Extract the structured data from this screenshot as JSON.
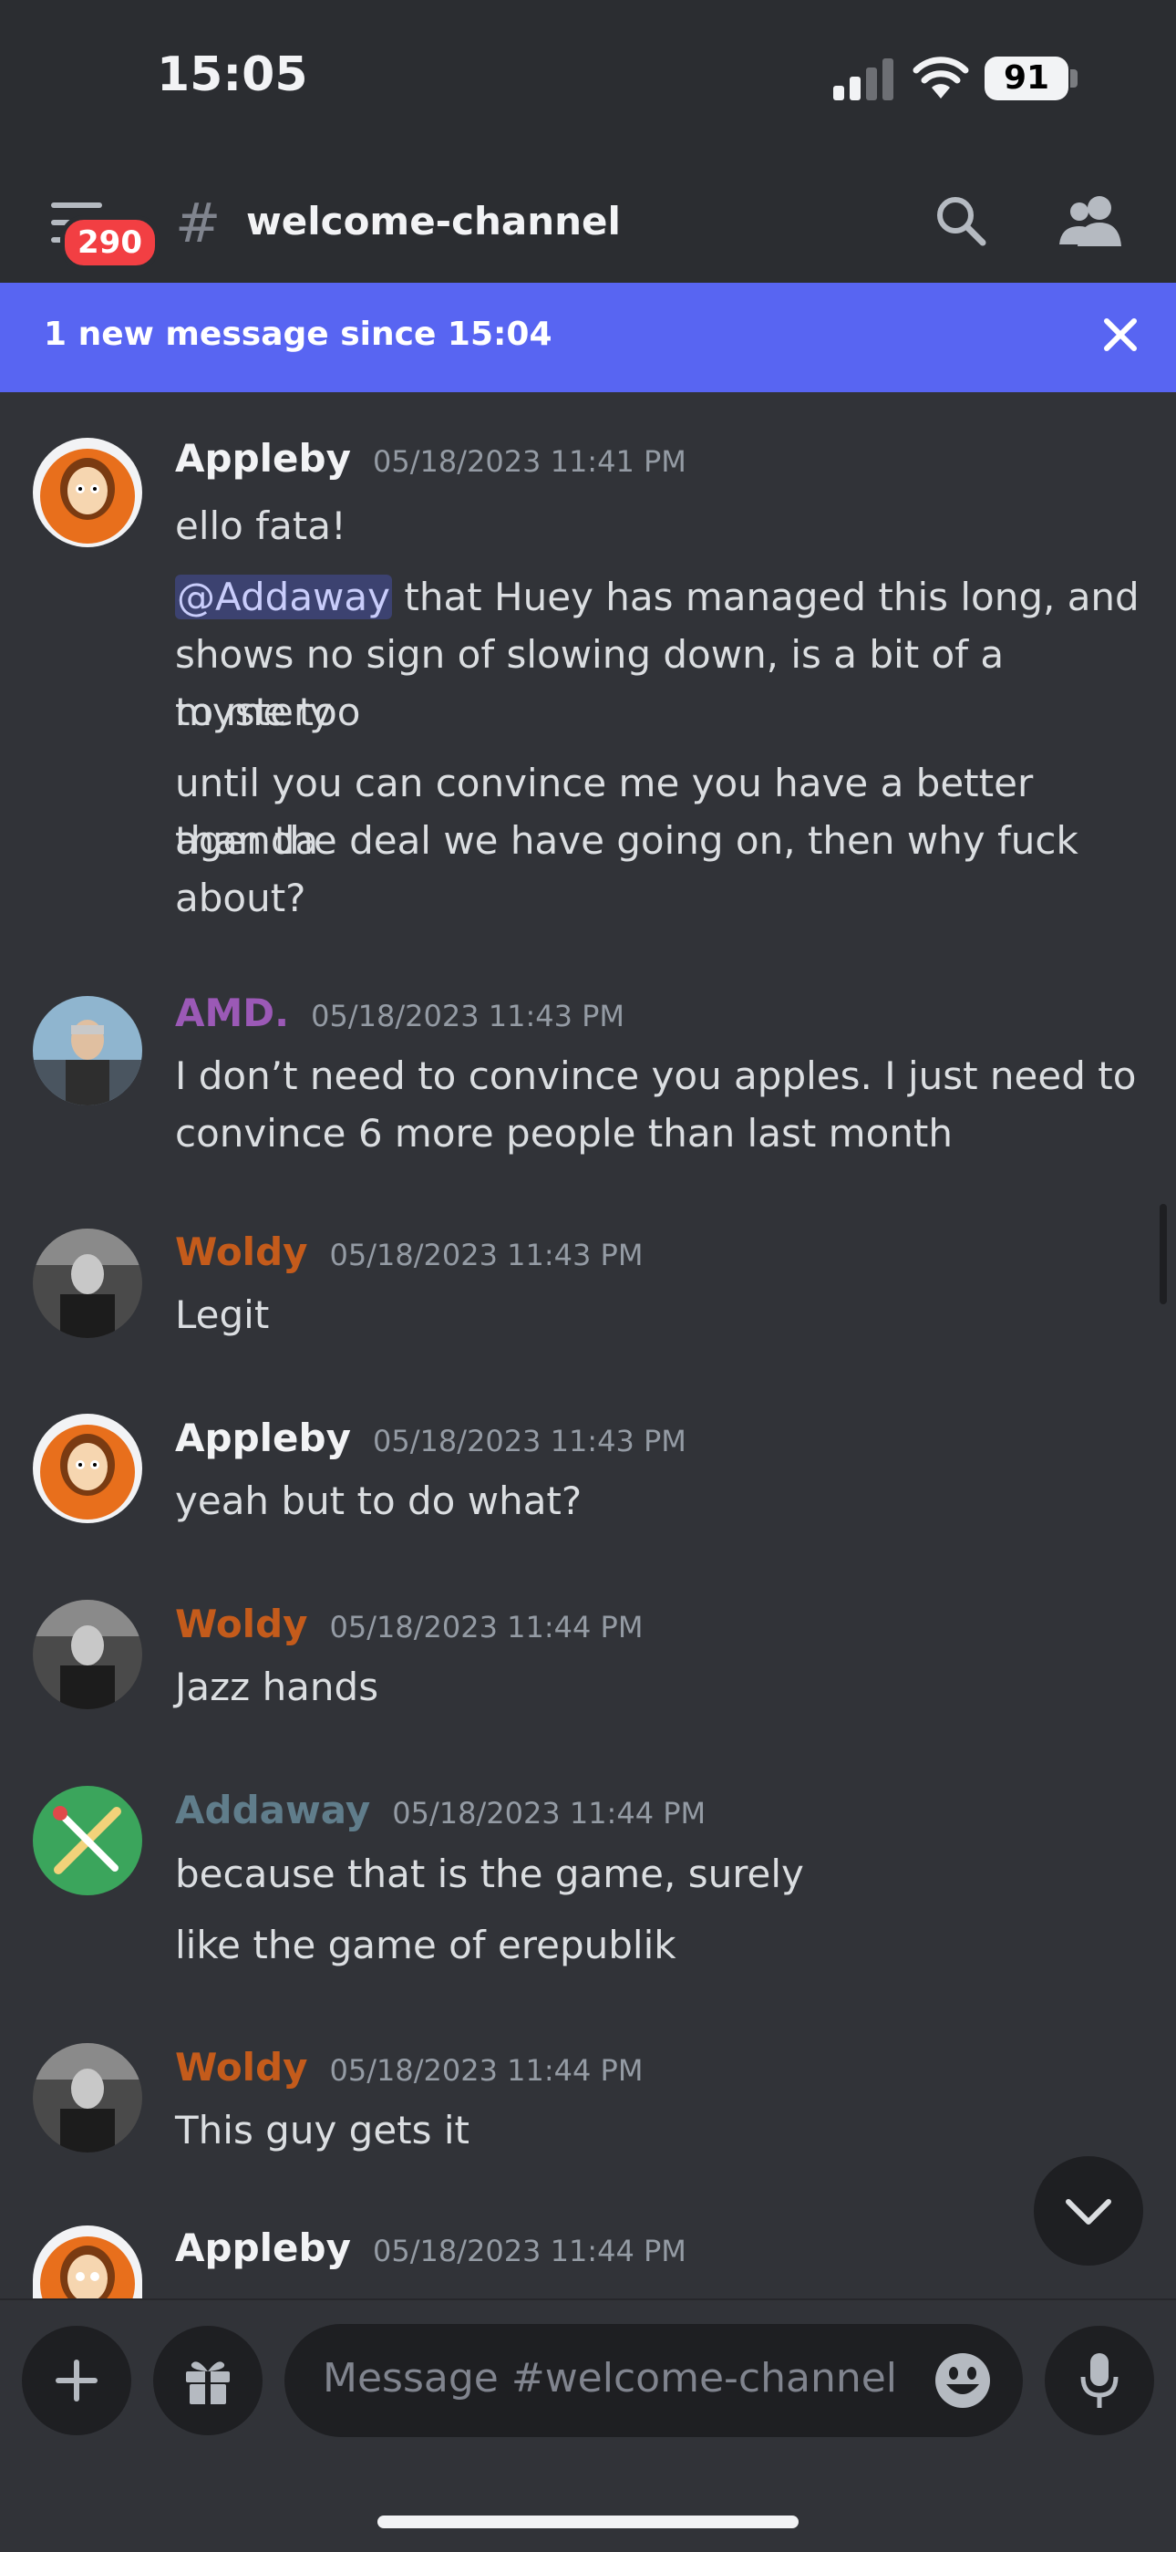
{
  "status_bar": {
    "time": "15:05",
    "battery": "91"
  },
  "header": {
    "unread_badge": "290",
    "channel_prefix": "#",
    "channel_name": "welcome-channel"
  },
  "banner": {
    "text": "1 new message since 15:04"
  },
  "messages": [
    {
      "author": "Appleby",
      "timestamp": "05/18/2023 11:41 PM",
      "lines": [
        "ello fata!",
        "that Huey has managed this long, and",
        "shows no sign of slowing down, is a bit of a mystery",
        "to me too",
        "until you can convince me you have a better agenda",
        "than the deal we have going on, then why fuck",
        "about?"
      ],
      "mention": "@Addaway"
    },
    {
      "author": "AMD.",
      "timestamp": "05/18/2023 11:43 PM",
      "lines": [
        "I don’t need to convince you apples. I just need to",
        "convince 6 more people than last month"
      ]
    },
    {
      "author": "Woldy",
      "timestamp": "05/18/2023 11:43 PM",
      "lines": [
        "Legit"
      ]
    },
    {
      "author": "Appleby",
      "timestamp": "05/18/2023 11:43 PM",
      "lines": [
        "yeah but to do what?"
      ]
    },
    {
      "author": "Woldy",
      "timestamp": "05/18/2023 11:44 PM",
      "lines": [
        "Jazz hands"
      ]
    },
    {
      "author": "Addaway",
      "timestamp": "05/18/2023 11:44 PM",
      "lines": [
        "because that is the game, surely",
        "like the game of erepublik"
      ]
    },
    {
      "author": "Woldy",
      "timestamp": "05/18/2023 11:44 PM",
      "lines": [
        "This guy gets it"
      ]
    },
    {
      "author": "Appleby",
      "timestamp": "05/18/2023 11:44 PM",
      "lines": []
    }
  ],
  "composer": {
    "placeholder": "Message #welcome-channel"
  },
  "colors": {
    "background": "#313338",
    "banner": "#5865f2",
    "badge": "#f23f43",
    "amd": "#9b59b6",
    "woldy": "#c45b1b",
    "addaway": "#607d8b"
  },
  "icons": [
    "signal-icon",
    "wifi-icon",
    "menu-icon",
    "search-icon",
    "members-icon",
    "close-icon",
    "chevron-down-icon",
    "plus-icon",
    "gift-icon",
    "emoji-icon",
    "microphone-icon"
  ]
}
